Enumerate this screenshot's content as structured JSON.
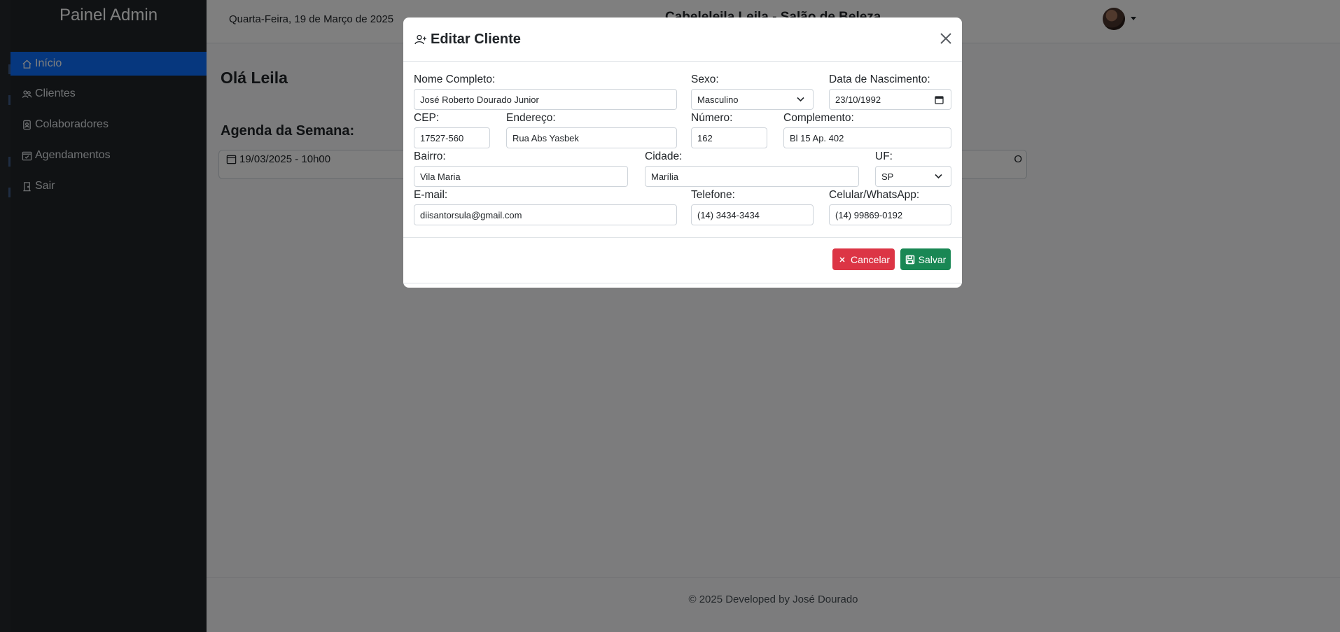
{
  "sidebar": {
    "brand": "Painel Admin",
    "items": [
      {
        "label": "Início",
        "icon": "house-icon",
        "active": true
      },
      {
        "label": "Clientes",
        "icon": "people-icon",
        "active": false
      },
      {
        "label": "Colaboradores",
        "icon": "person-badge-icon",
        "active": false
      },
      {
        "label": "Agendamentos",
        "icon": "calendar-check-icon",
        "active": false
      },
      {
        "label": "Sair",
        "icon": "door-icon",
        "active": false
      }
    ]
  },
  "topbar": {
    "date": "Quarta-Feira, 19 de Março de 2025",
    "title": "Cabeleleila Leila - Salão de Beleza"
  },
  "main": {
    "greeting": "Olá Leila",
    "agenda_title": "Agenda da Semana:",
    "agenda_items": [
      {
        "when": "19/03/2025 - 10h00",
        "right": "O"
      }
    ],
    "footer": "© 2025 Developed by José Dourado"
  },
  "modal": {
    "title": "Editar Cliente",
    "fields": {
      "nome": {
        "label": "Nome Completo:",
        "value": "José Roberto Dourado Junior"
      },
      "sexo": {
        "label": "Sexo:",
        "value": "Masculino"
      },
      "nascimento": {
        "label": "Data de Nascimento:",
        "value": "23/10/1992"
      },
      "cep": {
        "label": "CEP:",
        "value": "17527-560"
      },
      "endereco": {
        "label": "Endereço:",
        "value": "Rua Abs Yasbek"
      },
      "numero": {
        "label": "Número:",
        "value": "162"
      },
      "complemento": {
        "label": "Complemento:",
        "value": "Bl 15 Ap. 402"
      },
      "bairro": {
        "label": "Bairro:",
        "value": "Vila Maria"
      },
      "cidade": {
        "label": "Cidade:",
        "value": "Marília"
      },
      "uf": {
        "label": "UF:",
        "value": "SP"
      },
      "email": {
        "label": "E-mail:",
        "value": "diisantorsula@gmail.com"
      },
      "telefone": {
        "label": "Telefone:",
        "value": "(14) 3434-3434"
      },
      "celular": {
        "label": "Celular/WhatsApp:",
        "value": "(14) 99869-0192"
      }
    },
    "buttons": {
      "cancel": "Cancelar",
      "save": "Salvar"
    }
  },
  "colors": {
    "sidebar_bg": "#212529",
    "active_nav": "#0d6efd",
    "cancel": "#dc3545",
    "save": "#198754"
  }
}
